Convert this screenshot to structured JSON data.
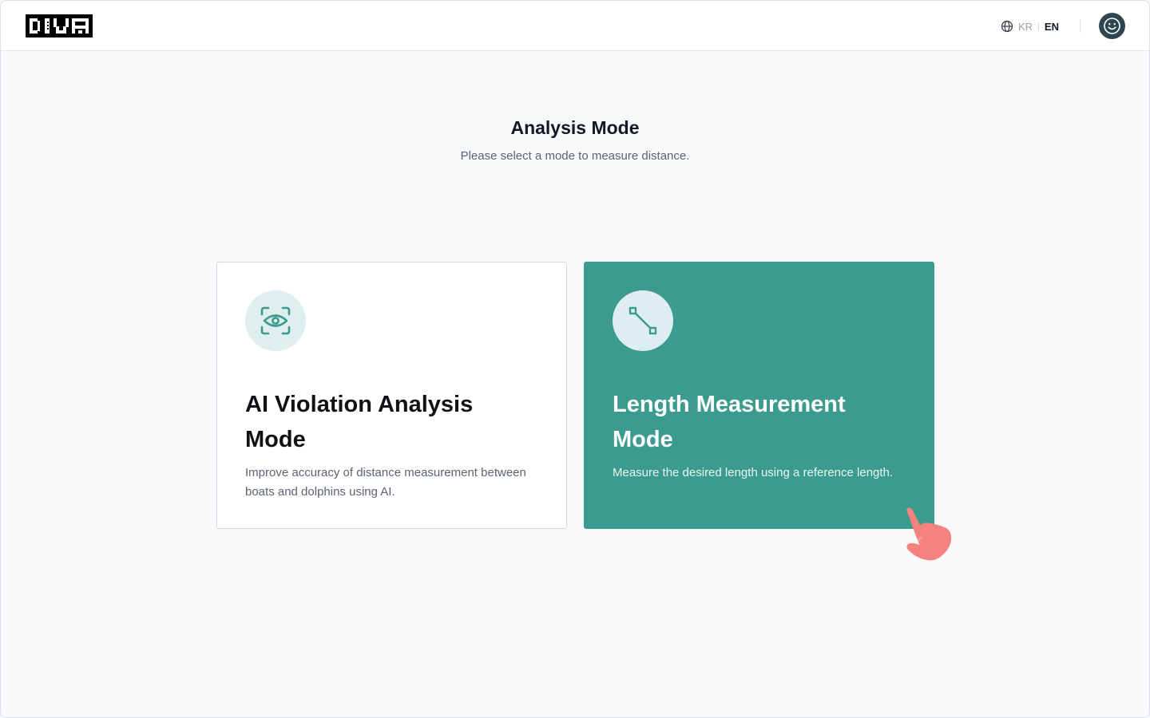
{
  "app": {
    "logo_text": "DIVA"
  },
  "header": {
    "language": {
      "icon": "globe-icon",
      "options": [
        "KR",
        "EN"
      ],
      "separator": "|",
      "selected": "EN"
    },
    "profile_icon": "smiley-icon"
  },
  "main": {
    "title": "Analysis Mode",
    "subtitle": "Please select a mode to measure distance.",
    "cards": [
      {
        "icon": "eye-scan-icon",
        "title": "AI Violation Analysis Mode",
        "description": "Improve accuracy of distance measurement between boats and dolphins using AI.",
        "selected": false
      },
      {
        "icon": "measure-line-icon",
        "title": "Length Measurement Mode",
        "description": "Measure the desired length using a reference length.",
        "selected": true
      }
    ]
  },
  "colors": {
    "accent": "#3b9b8f",
    "icon_bg": "#dfeeee",
    "avatar_bg": "#2f4550",
    "pointer": "#f4827f"
  },
  "cursor_icon": "hand-pointer-icon"
}
